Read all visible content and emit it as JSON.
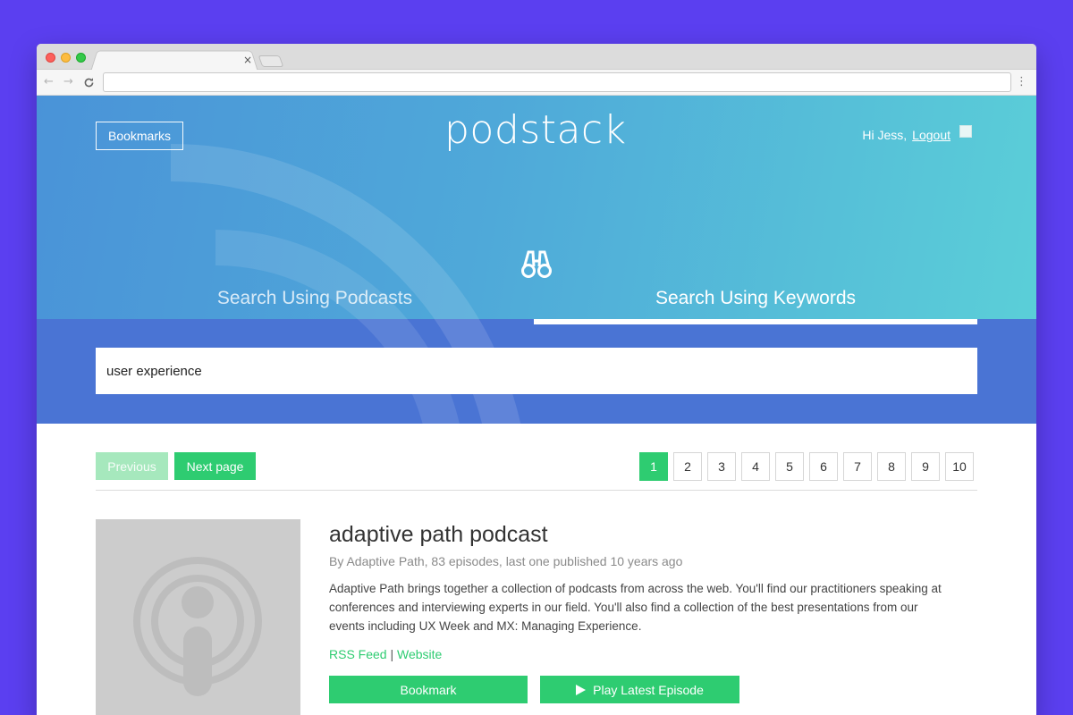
{
  "browser": {
    "tab_close": "×",
    "nav_back": "←",
    "nav_forward": "→",
    "reload": "C",
    "menu": "⋮",
    "url": ""
  },
  "header": {
    "bookmarks_label": "Bookmarks",
    "logo_text": "podstack",
    "greeting": "Hi Jess,",
    "logout_label": "Logout"
  },
  "search": {
    "tabs": [
      {
        "label": "Search Using Podcasts",
        "active": false
      },
      {
        "label": "Search Using Keywords",
        "active": true
      }
    ],
    "query": "user experience"
  },
  "pagination": {
    "previous_label": "Previous",
    "next_label": "Next page",
    "pages": [
      "1",
      "2",
      "3",
      "4",
      "5",
      "6",
      "7",
      "8",
      "9",
      "10"
    ],
    "current_page": "1"
  },
  "result": {
    "title": "adaptive path podcast",
    "meta": "By Adaptive Path, 83 episodes, last one published 10 years ago",
    "description": "Adaptive Path brings together a collection of podcasts from across the web. You'll find our practitioners speaking at conferences and interviewing experts in our field. You'll also find a collection of the best presentations from our events including UX Week and MX: Managing Experience.",
    "rss_label": "RSS Feed",
    "separator": "|",
    "website_label": "Website",
    "bookmark_label": "Bookmark",
    "play_label": "Play Latest Episode"
  },
  "colors": {
    "background": "#5b3ff0",
    "accent_green": "#2ecc71",
    "hero_blue": "#4a74d4"
  }
}
